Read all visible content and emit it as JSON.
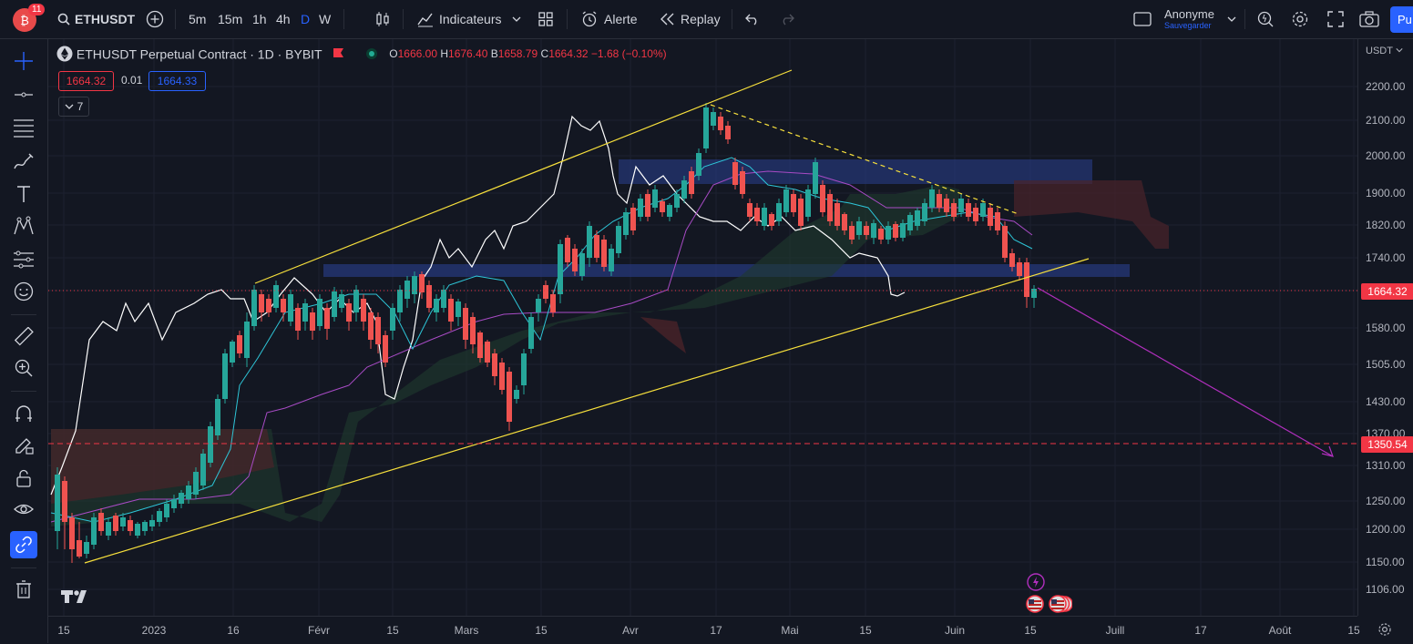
{
  "topbar": {
    "notif_count": "11",
    "symbol": "ETHUSDT",
    "intervals": [
      "5m",
      "15m",
      "1h",
      "4h",
      "D",
      "W"
    ],
    "active_interval": "D",
    "indicators_label": "Indicateurs",
    "alert_label": "Alerte",
    "replay_label": "Replay",
    "user_name": "Anonyme",
    "user_status": "Sauvegarder",
    "publish_label": "Pu"
  },
  "legend": {
    "title": "ETHUSDT Perpetual Contract · 1D · BYBIT",
    "o_label": "O",
    "o_val": "1666.00",
    "h_label": "H",
    "h_val": "1676.40",
    "b_label": "B",
    "b_val": "1658.79",
    "c_label": "C",
    "c_val": "1664.32",
    "change": "−1.68 (−0.10%)",
    "bid": "1664.32",
    "spread": "0.01",
    "ask": "1664.33",
    "indicators_count": "7"
  },
  "colors": {
    "bull": "#26a69a",
    "bear": "#ef5350",
    "channel": "#f7e03c",
    "projection": "#b02fbd",
    "zone": "#2a3f8f",
    "cloud_bull": "#1f3b2e",
    "cloud_bear": "#4a2329"
  },
  "price_axis": {
    "currency": "USDT",
    "ticks": [
      "2200.00",
      "2100.00",
      "2000.00",
      "1900.00",
      "1820.00",
      "1740.00",
      "1580.00",
      "1505.00",
      "1430.00",
      "1370.00",
      "1310.00",
      "1250.00",
      "1200.00",
      "1150.00",
      "1106.00"
    ],
    "last_price": "1664.32",
    "target_price": "1350.54"
  },
  "time_axis": {
    "labels": [
      "15",
      "2023",
      "16",
      "Févr",
      "15",
      "Mars",
      "15",
      "Avr",
      "17",
      "Mai",
      "15",
      "Juin",
      "15",
      "Juill",
      "17",
      "Août",
      "15"
    ]
  },
  "chart_data": {
    "type": "candlestick",
    "symbol": "ETHUSDT",
    "interval": "1D",
    "exchange": "BYBIT",
    "scale": "log",
    "last_close": 1664.32,
    "target": 1350.54,
    "annotations": [
      "ascending channel (yellow)",
      "descending trendline (dashed yellow)",
      "resistance zones (blue)",
      "projection arrow down to 1350.54"
    ]
  }
}
